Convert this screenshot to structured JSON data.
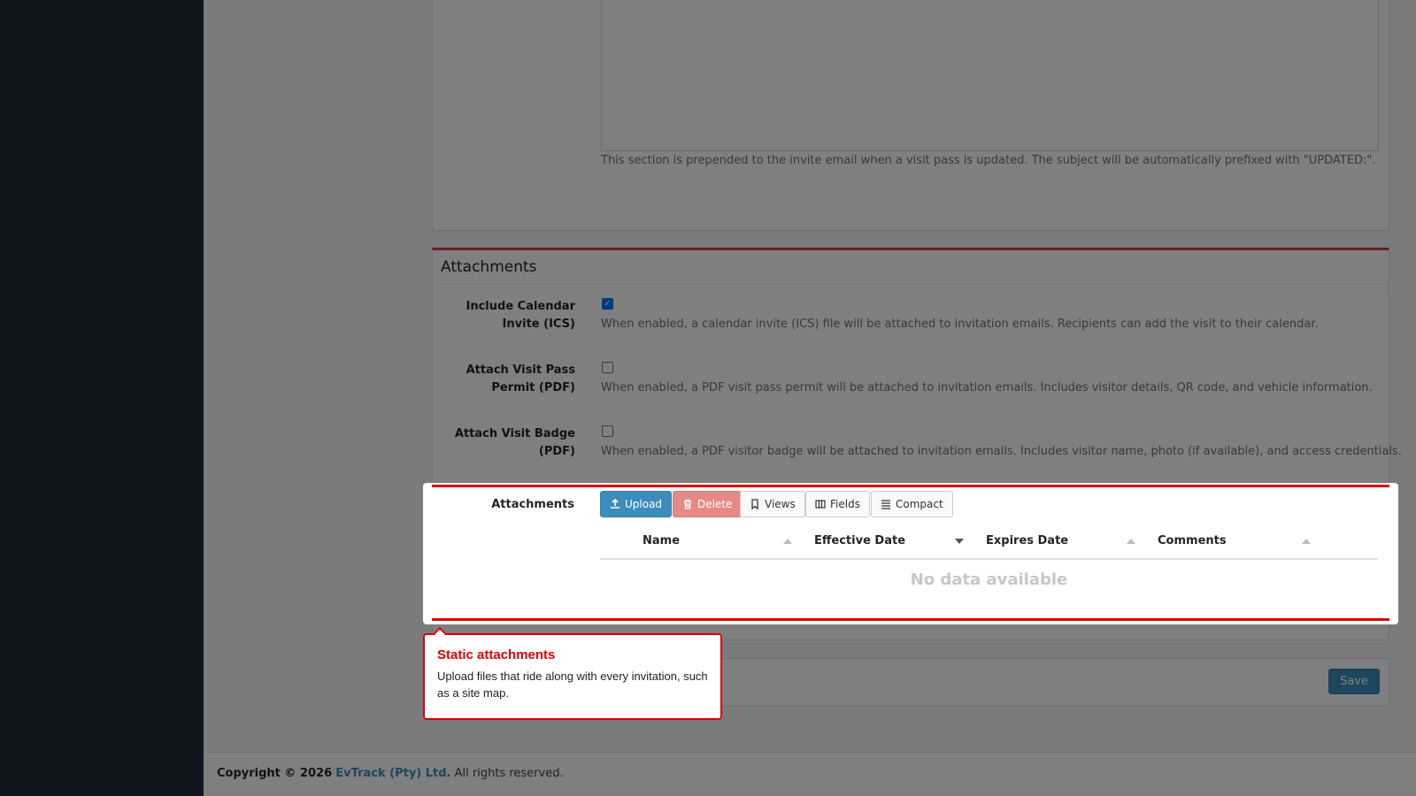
{
  "top_section": {
    "help_text": "This section is prepended to the invite email when a visit pass is updated. The subject will be automatically prefixed with \"UPDATED:\"."
  },
  "attachments_card": {
    "title": "Attachments",
    "fields": [
      {
        "label": "Include Calendar Invite (ICS)",
        "checked": true,
        "help": "When enabled, a calendar invite (ICS) file will be attached to invitation emails. Recipients can add the visit to their calendar."
      },
      {
        "label": "Attach Visit Pass Permit (PDF)",
        "checked": false,
        "help": "When enabled, a PDF visit pass permit will be attached to invitation emails. Includes visitor details, QR code, and vehicle information."
      },
      {
        "label": "Attach Visit Badge (PDF)",
        "checked": false,
        "help": "When enabled, a PDF visitor badge will be attached to invitation emails. Includes visitor name, photo (if available), and access credentials."
      }
    ],
    "attachments_label": "Attachments",
    "toolbar": {
      "upload": "Upload",
      "delete": "Delete",
      "views": "Views",
      "fields": "Fields",
      "compact": "Compact"
    },
    "columns": [
      "Name",
      "Effective Date",
      "Expires Date",
      "Comments"
    ],
    "sorted_column": "Effective Date",
    "empty_message": "No data available"
  },
  "save_label": "Save",
  "tooltip": {
    "title": "Static attachments",
    "text": "Upload files that ride along with every invitation, such as a site map."
  },
  "footer": {
    "prefix": "Copyright © 2026",
    "company": "EvTrack (Pty) Ltd.",
    "suffix": "All rights reserved."
  },
  "colors": {
    "highlight": "#dc0000",
    "primary": "#3c8dbc",
    "sidebar": "#1f2d3d"
  }
}
